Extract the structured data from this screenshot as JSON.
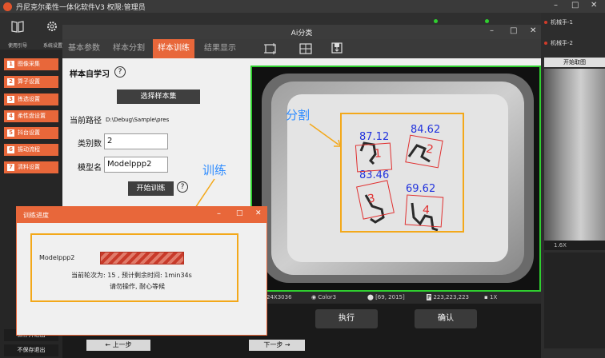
{
  "app": {
    "title": "丹尼克尔柔性一体化软件V3",
    "permission": "权限:管理员"
  },
  "toolbar": {
    "items": [
      {
        "label": "使用引导",
        "icon": "book-icon"
      },
      {
        "label": "系统设置",
        "icon": "gear-icon"
      }
    ]
  },
  "robots": [
    {
      "label": "机械手-1"
    },
    {
      "label": "机械手-2"
    }
  ],
  "sidebar": {
    "items": [
      {
        "num": "1",
        "label": "图像采集"
      },
      {
        "num": "2",
        "label": "算子设置"
      },
      {
        "num": "3",
        "label": "拣选设置"
      },
      {
        "num": "4",
        "label": "柔性盘设置"
      },
      {
        "num": "5",
        "label": "抖台设置"
      },
      {
        "num": "6",
        "label": "振动流程"
      },
      {
        "num": "7",
        "label": "清料设置"
      }
    ],
    "save_exit": "保存并退出",
    "nosave_exit": "不保存退出"
  },
  "right_panel": {
    "button": "开始取图",
    "zoom": "1.6X"
  },
  "ai_dialog": {
    "title": "Ai分类",
    "tabs": [
      {
        "label": "基本参数"
      },
      {
        "label": "样本分割"
      },
      {
        "label": "样本训练"
      },
      {
        "label": "结果显示"
      }
    ],
    "active_tab": 2,
    "section_title": "样本自学习",
    "help_icon": "?",
    "select_button": "选择样本集",
    "path_label": "当前路径",
    "path_value": "D:\\Debug\\Sample\\pres",
    "class_label": "类别数",
    "class_value": "2",
    "model_label": "模型名",
    "model_value": "Modelppp2",
    "train_button": "开始训练",
    "status": {
      "res": "24X3036",
      "color": "Color3",
      "pos": "[69, 2015]",
      "rgb": "223,223,223",
      "zoom": "1X"
    },
    "execute_button": "执行",
    "confirm_button": "确认",
    "prev_button": "← 上一步",
    "next_button": "下一步 →"
  },
  "image": {
    "segment_label": "分割",
    "parts": [
      {
        "score": "87.12",
        "id": "1"
      },
      {
        "score": "84.62",
        "id": "2"
      },
      {
        "score": "83.46",
        "id": "3"
      },
      {
        "score": "69.62",
        "id": "4"
      }
    ]
  },
  "annotation": {
    "train_label": "训练"
  },
  "progress_dialog": {
    "title": "训练进度",
    "model_name": "Modelppp2",
    "progress": 1.0,
    "status_line": "当前轮次为:  15 , 预计剩余时间:    1min34s",
    "wait_line": "请勿操作, 耐心等候"
  },
  "colors": {
    "accent": "#e8673a",
    "highlight": "#f3a81a",
    "image_border": "#2fcf2f",
    "label_blue": "#2233dd",
    "seg_label": "#2f8cff"
  }
}
